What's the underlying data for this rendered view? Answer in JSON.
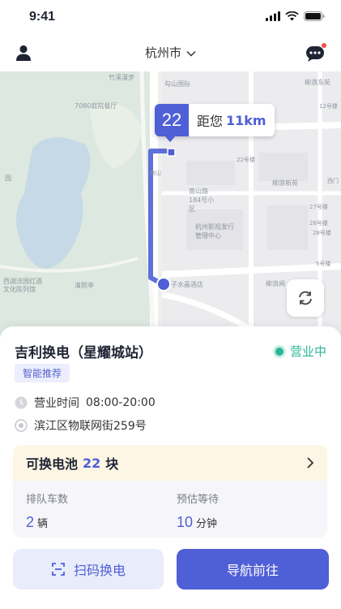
{
  "status_bar": {
    "time": "9:41"
  },
  "header": {
    "city": "杭州市"
  },
  "map": {
    "labels": {
      "l1": "竹溪漫步",
      "l2": "勾山国际",
      "l3": "柳浪东苑",
      "l4": "7080庭院餐厅",
      "l5": "12号楼",
      "l6": "南山",
      "l7": "22号楼",
      "l8": "柳浪新苑",
      "l9": "西门",
      "l10": "南山路184号小区",
      "l11": "杭州影视发行管理中心",
      "l12": "27号楼",
      "l13": "28号楼",
      "l14": "5号楼",
      "l15": "西湖法国红酒文化陈列馆",
      "l16": "清照亭",
      "l17": "子水晶酒店",
      "l18": "柳浪闻",
      "l19": "28号楼",
      "l20": "园"
    },
    "route_number": "22",
    "distance_label": "距您",
    "distance_value": "11km"
  },
  "station": {
    "name": "吉利换电（星耀城站）",
    "status": "营业中",
    "tag": "智能推荐",
    "hours_label": "营业时间",
    "hours_value": "08:00-20:00",
    "address": "滨江区物联网街259号"
  },
  "battery": {
    "label": "可换电池",
    "count": "22",
    "unit": "块",
    "queue_label": "排队车数",
    "queue_value": "2",
    "queue_unit": "辆",
    "wait_label": "预估等待",
    "wait_value": "10",
    "wait_unit": "分钟"
  },
  "actions": {
    "scan": "扫码换电",
    "navigate": "导航前往"
  },
  "colors": {
    "primary": "#4f5fd6",
    "success": "#2bb596",
    "tag_bg": "#eceefe",
    "card_header": "#fdf6e5"
  }
}
